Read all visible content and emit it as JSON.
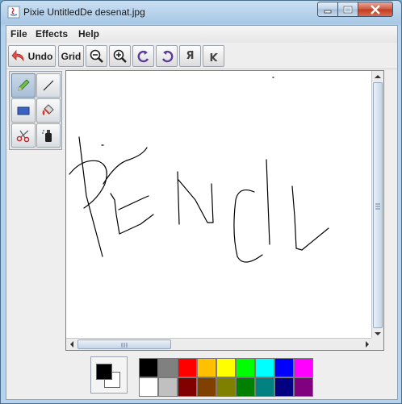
{
  "window": {
    "title": "Pixie UntitledDe desenat.jpg"
  },
  "menu": {
    "items": [
      "File",
      "Effects",
      "Help"
    ]
  },
  "toolbar": {
    "undo_label": "Undo",
    "grid_label": "Grid",
    "flip_h_glyph": "Я",
    "flip_v_glyph": "K"
  },
  "tools": [
    "pencil",
    "line",
    "rectangle",
    "fill-bucket",
    "scissors",
    "spray-can"
  ],
  "selected_tool": "pencil",
  "canvas": {
    "drawn_text": "PENCIL"
  },
  "colors": {
    "foreground": "#000000",
    "background": "#ffffff",
    "palette_top": [
      "#000000",
      "#808080",
      "#ff0000",
      "#ffc000",
      "#ffff00",
      "#00ff00",
      "#00ffff",
      "#0000ff",
      "#ff00ff"
    ],
    "palette_bottom": [
      "#ffffff",
      "#c0c0c0",
      "#800000",
      "#804000",
      "#808000",
      "#008000",
      "#008080",
      "#000080",
      "#800080"
    ]
  }
}
